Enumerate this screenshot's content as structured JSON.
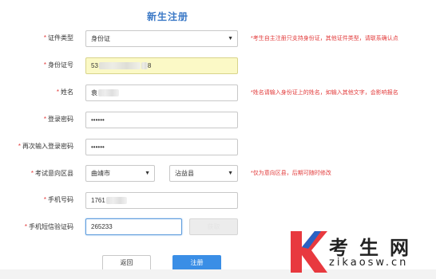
{
  "page": {
    "title": "新生注册"
  },
  "form": {
    "id_type": {
      "label": "证件类型",
      "value": "身份证",
      "hint": "*考生自主注册只支持身份证，其他证件类型，请联系确认点"
    },
    "id_number": {
      "label": "身份证号",
      "value_prefix": "53",
      "value_suffix": "8"
    },
    "name": {
      "label": "姓名",
      "value": "袁",
      "hint": "*姓名请输入身份证上的姓名，如输入其他文字，会影响报名"
    },
    "password": {
      "label": "登录密码",
      "value": "••••••"
    },
    "password_confirm": {
      "label": "再次输入登录密码",
      "value": "••••••"
    },
    "region": {
      "label": "考试意向区县",
      "city": "曲靖市",
      "county": "沾益县",
      "hint": "*仅为意向区县，后期可随时修改"
    },
    "phone": {
      "label": "手机号码",
      "value_prefix": "1761"
    },
    "sms_code": {
      "label": "手机短信验证码",
      "value": "265233",
      "send_button": "获取"
    }
  },
  "buttons": {
    "back": "返回",
    "submit": "注册"
  },
  "watermark": {
    "cn": "考生网",
    "en": "zikaosw.cn"
  },
  "colors": {
    "accent": "#3a8ee6",
    "title": "#3a78c6",
    "required": "#e23b3b",
    "autofill": "#fbf9c6"
  }
}
